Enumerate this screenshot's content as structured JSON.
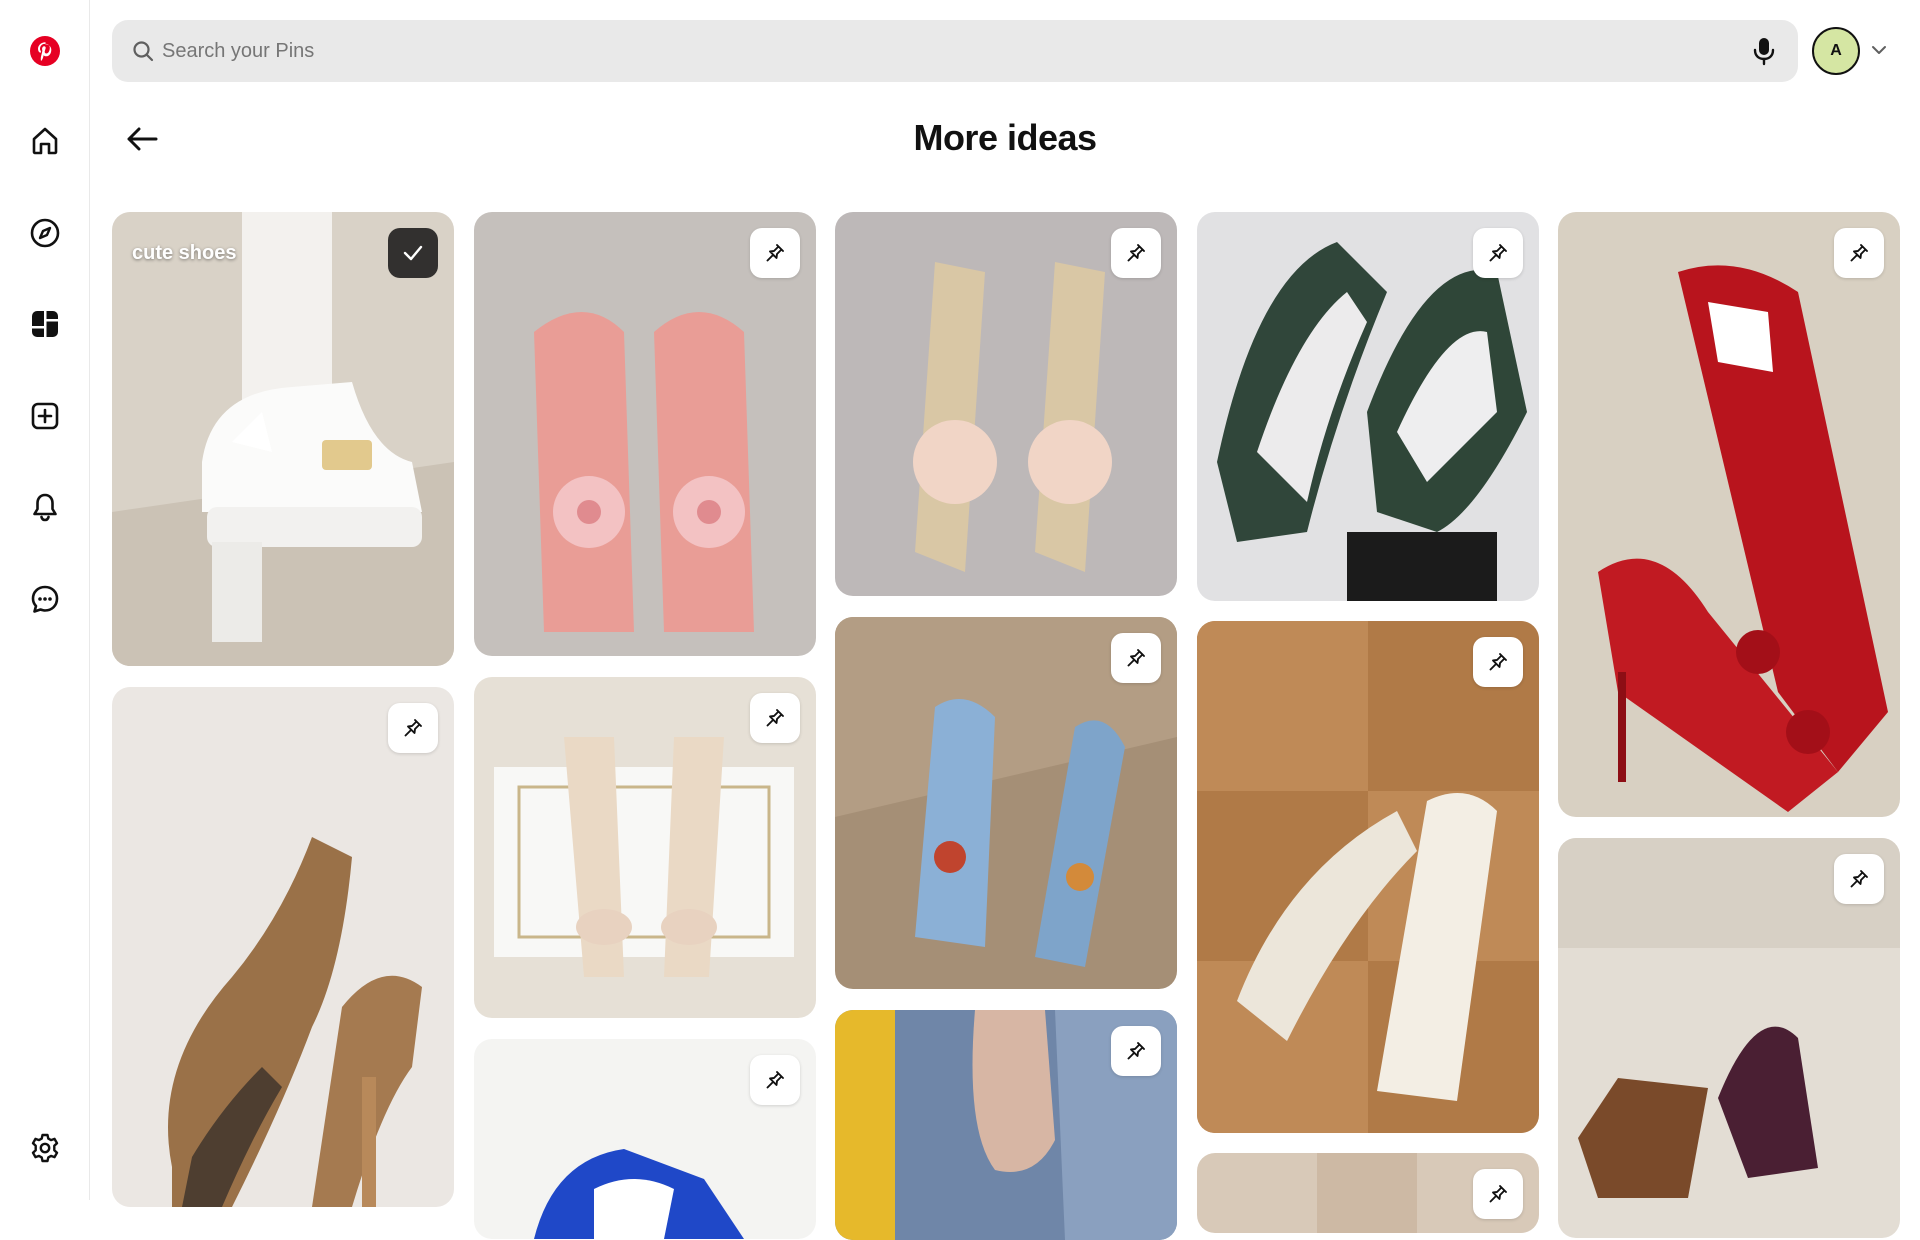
{
  "app": {
    "name": "Pinterest",
    "brand_color": "#e60023"
  },
  "sidebar": {
    "items": [
      {
        "name": "home",
        "icon": "home-icon"
      },
      {
        "name": "explore",
        "icon": "compass-icon"
      },
      {
        "name": "boards",
        "icon": "boards-icon",
        "active": true
      },
      {
        "name": "create",
        "icon": "plus-square-icon"
      },
      {
        "name": "notifications",
        "icon": "bell-icon"
      },
      {
        "name": "messages",
        "icon": "chat-icon"
      }
    ],
    "settings_icon": "gear-icon"
  },
  "search": {
    "placeholder": "Search your Pins",
    "value": ""
  },
  "user": {
    "avatar_initial": "A",
    "avatar_color": "#d5e6a3"
  },
  "page": {
    "title": "More ideas"
  },
  "pins": [
    {
      "board_label": "cute shoes",
      "saved": true,
      "description": "white platform heels with bow and lace socks"
    },
    {
      "saved": false,
      "description": "pink sandals with orchid flowers"
    },
    {
      "saved": false,
      "description": "flower strappy heels on lace"
    },
    {
      "saved": false,
      "description": "green and white sneakers"
    },
    {
      "saved": false,
      "description": "red strappy heels with flowers"
    },
    {
      "saved": false,
      "description": "brown slingback heels"
    },
    {
      "saved": false,
      "description": "satin bow sandals with box"
    },
    {
      "saved": false,
      "description": "blue lace-up sandals in sand"
    },
    {
      "saved": false,
      "description": "white bow mules on tile"
    },
    {
      "saved": false,
      "description": "purple platform sandals on couch"
    },
    {
      "saved": false,
      "description": "blue sneaker"
    },
    {
      "saved": false,
      "description": "hand on denim"
    },
    {
      "saved": false,
      "description": "beige shoe"
    }
  ]
}
